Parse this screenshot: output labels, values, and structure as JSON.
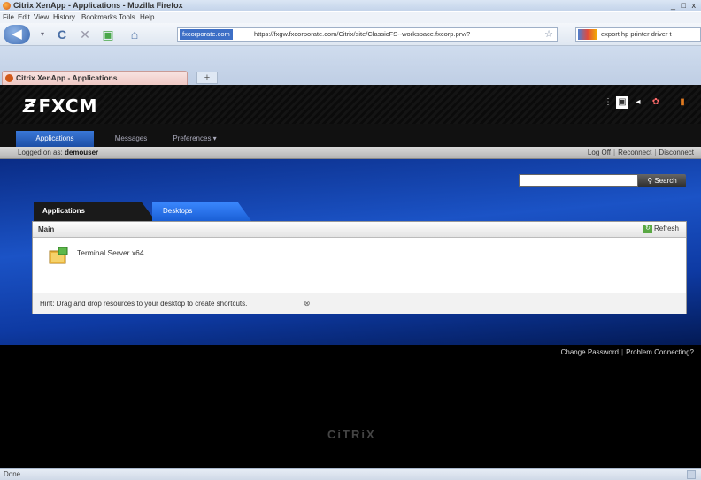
{
  "window": {
    "title": "Citrix XenApp - Applications - Mozilla Firefox",
    "controls": "_ □ x"
  },
  "menu": [
    "File",
    "Edit",
    "View",
    "History",
    "Bookmarks",
    "Tools",
    "Help"
  ],
  "nav": {
    "back": "◀",
    "reload": "C",
    "stop": "✕",
    "home": "⌂",
    "site_badge": "fxcorporate.com",
    "url": "https://fxgw.fxcorporate.com/Citrix/site/ClassicFS--workspace.fxcorp.prv/?",
    "search_text": "export hp printer driver t"
  },
  "browser_tab": {
    "label": "Citrix XenApp - Applications",
    "new_tab": "+"
  },
  "header": {
    "logo": "FXCM"
  },
  "top_tabs": [
    "Applications",
    "Messages",
    "Preferences ▾"
  ],
  "user_bar": {
    "prefix": "Logged on as: ",
    "user": "demouser",
    "links": [
      "Log Off",
      "Reconnect",
      "Disconnect"
    ]
  },
  "search": {
    "button": "Search"
  },
  "panel_tabs": [
    "Applications",
    "Desktops"
  ],
  "panel": {
    "heading": "Main",
    "refresh": "Refresh",
    "resource": "Terminal Server x64",
    "hint": "Hint: Drag and drop resources to your desktop to create shortcuts."
  },
  "footer_links": [
    "Change Password",
    "Problem Connecting?"
  ],
  "brand": "CiTRiX",
  "status": {
    "text": "Done"
  },
  "colors": {
    "accent_blue": "#1d4fa6",
    "page_bg": "#000000"
  }
}
